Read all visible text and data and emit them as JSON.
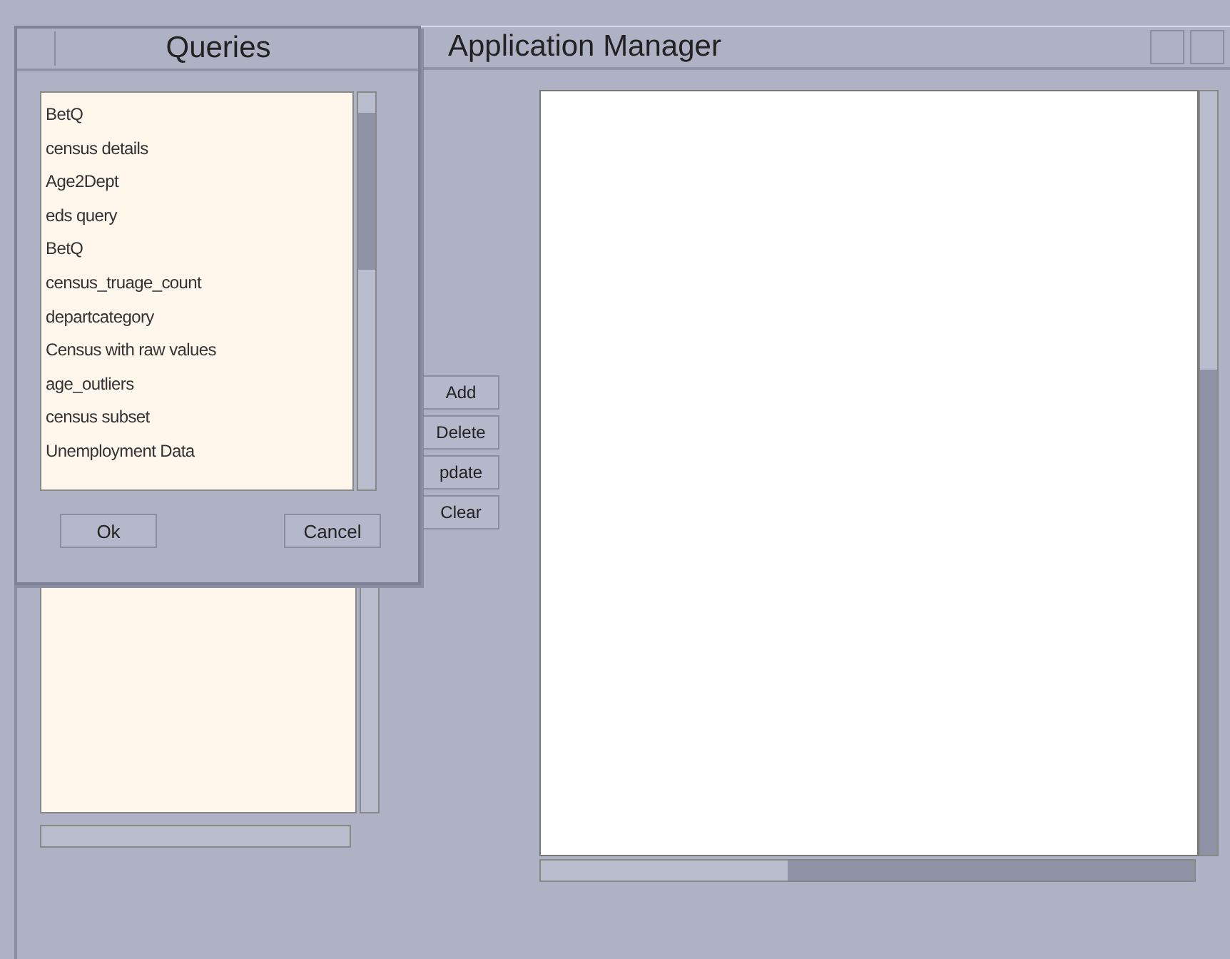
{
  "window": {
    "title": "Application Manager"
  },
  "buttons": [
    {
      "label": "Add"
    },
    {
      "label": "Delete"
    },
    {
      "label": "pdate"
    },
    {
      "label": "Clear"
    }
  ],
  "dialog": {
    "title": "Queries",
    "items": [
      "BetQ",
      "census details",
      "Age2Dept",
      "eds query",
      "BetQ",
      "census_truage_count",
      "departcategory",
      "Census with raw values",
      "age_outliers",
      "census subset",
      "Unemployment Data"
    ],
    "buttons": [
      {
        "label": "Ok"
      },
      {
        "label": "Cancel"
      }
    ]
  }
}
